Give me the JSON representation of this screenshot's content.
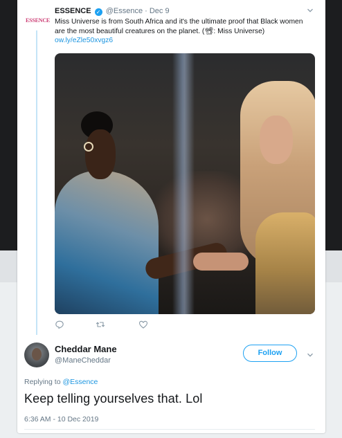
{
  "original_tweet": {
    "author_name": "ESSENCE",
    "author_handle": "@Essence",
    "separator": "·",
    "date": "Dec 9",
    "logo_text": "ESSENCE",
    "verified": true,
    "text_line1": "Miss Universe is from South Africa and it's the ultimate proof that Black women",
    "text_line2": "are the most beautiful creatures on the planet.  (📽: Miss Universe)",
    "link": "ow.ly/eZle50xvgz6",
    "media_description_icon": "photo"
  },
  "reply_tweet": {
    "author_name": "Cheddar Mane",
    "author_handle": "@ManeCheddar",
    "follow_label": "Follow",
    "replying_prefix": "Replying to",
    "replying_handle": "@Essence",
    "text": "Keep telling yourselves that.  Lol",
    "timestamp": "6:36 AM - 10 Dec 2019"
  },
  "icons": {
    "reply": "reply-icon",
    "retweet": "retweet-icon",
    "like": "heart-icon",
    "more": "chevron-down-icon"
  },
  "colors": {
    "accent": "#1da1f2",
    "link": "#1b95e0",
    "muted": "#657786",
    "thread_line": "#c4e4f7",
    "brand": "#cc3d74"
  }
}
